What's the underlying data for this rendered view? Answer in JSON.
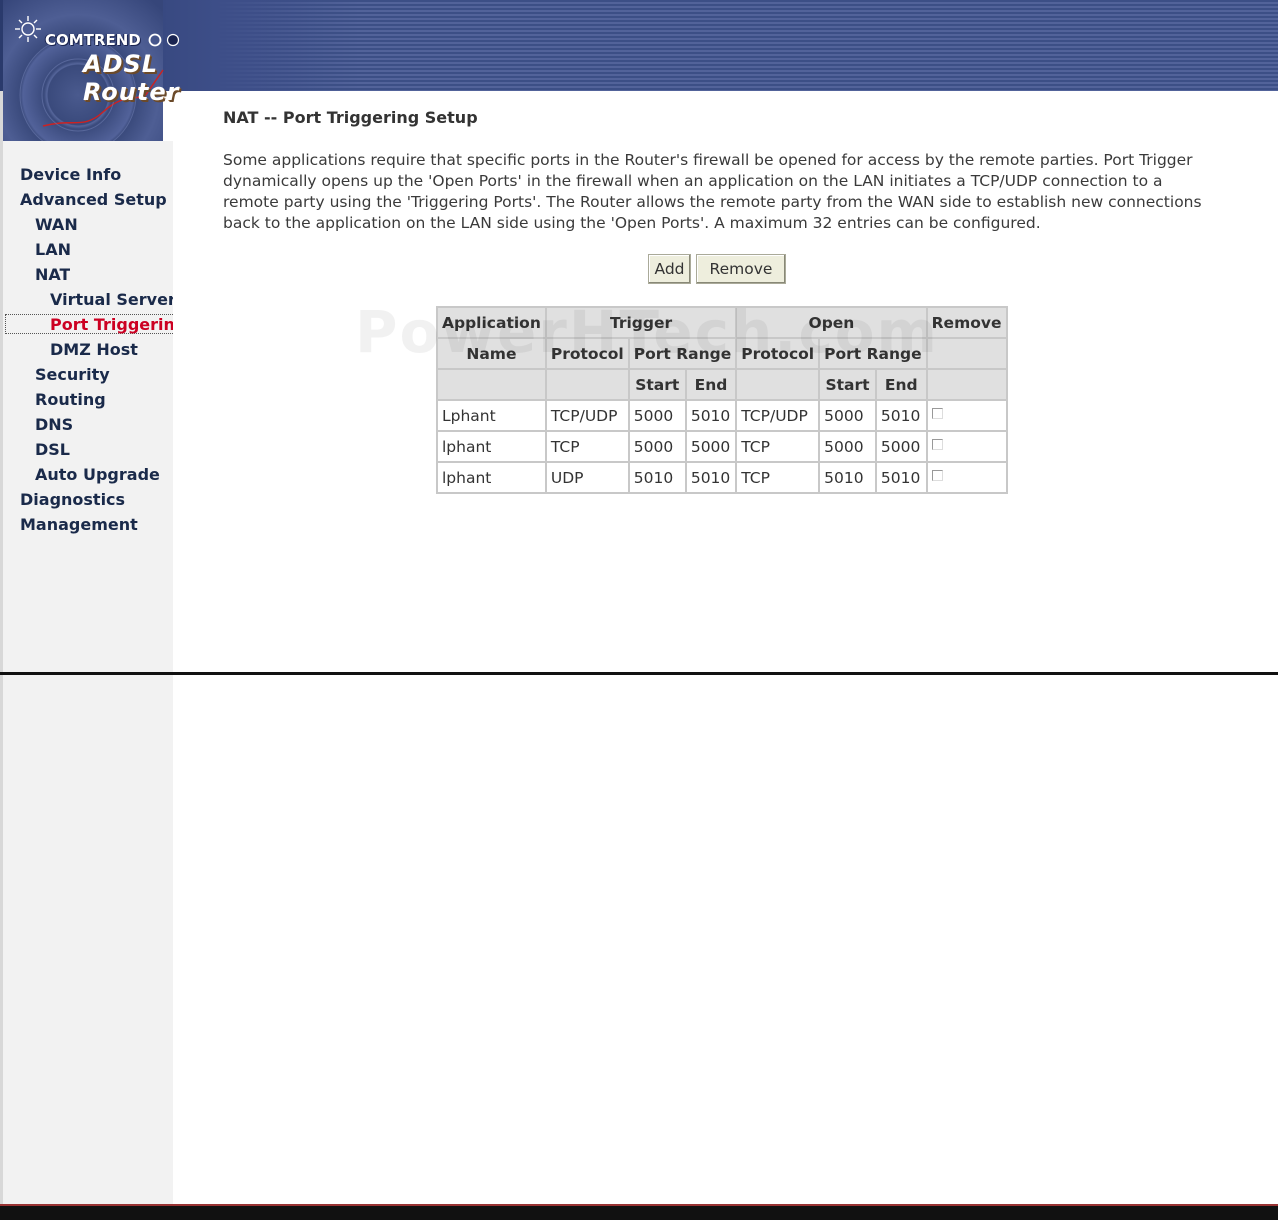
{
  "header": {
    "brand": "COMTREND",
    "product": "ADSL Router"
  },
  "sidebar": {
    "items": [
      {
        "label": "Device Info"
      },
      {
        "label": "Advanced Setup"
      },
      {
        "label": "WAN"
      },
      {
        "label": "LAN"
      },
      {
        "label": "NAT"
      },
      {
        "label": "Virtual Servers"
      },
      {
        "label": "Port Triggering"
      },
      {
        "label": "DMZ Host"
      },
      {
        "label": "Security"
      },
      {
        "label": "Routing"
      },
      {
        "label": "DNS"
      },
      {
        "label": "DSL"
      },
      {
        "label": "Auto Upgrade"
      },
      {
        "label": "Diagnostics"
      },
      {
        "label": "Management"
      }
    ],
    "active_item": "Port Triggering"
  },
  "main": {
    "title": "NAT -- Port Triggering Setup",
    "description": "Some applications require that specific ports in the Router's firewall be opened for access by the remote parties. Port Trigger dynamically opens up the 'Open Ports' in the firewall when an application on the LAN initiates a TCP/UDP connection to a remote party using the 'Triggering Ports'. The Router allows the remote party from the WAN side to establish new connections back to the application on the LAN side using the 'Open Ports'. A maximum 32 entries can be configured.",
    "buttons": {
      "add": "Add",
      "remove": "Remove"
    },
    "watermark": "PowerHTech.com"
  },
  "table": {
    "headers": {
      "application": "Application",
      "trigger": "Trigger",
      "open": "Open",
      "remove": "Remove",
      "name": "Name",
      "protocol": "Protocol",
      "port_range": "Port Range",
      "start": "Start",
      "end": "End"
    },
    "rows": [
      {
        "name": "Lphant",
        "trigger_protocol": "TCP/UDP",
        "trigger_start": "5000",
        "trigger_end": "5010",
        "open_protocol": "TCP/UDP",
        "open_start": "5000",
        "open_end": "5010"
      },
      {
        "name": "lphant",
        "trigger_protocol": "TCP",
        "trigger_start": "5000",
        "trigger_end": "5000",
        "open_protocol": "TCP",
        "open_start": "5000",
        "open_end": "5000"
      },
      {
        "name": "lphant",
        "trigger_protocol": "UDP",
        "trigger_start": "5010",
        "trigger_end": "5010",
        "open_protocol": "TCP",
        "open_start": "5010",
        "open_end": "5010"
      }
    ]
  },
  "colors": {
    "header_blue": "#3c4f86",
    "active_nav": "#cc0022",
    "sidebar_bg": "#f2f2f2",
    "table_header_bg": "#e0e0e0"
  }
}
